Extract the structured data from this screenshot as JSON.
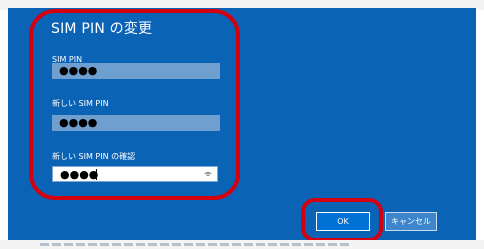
{
  "dialog": {
    "title": "SIM PIN の変更",
    "fields": [
      {
        "label": "SIM PIN",
        "value": "●●●●"
      },
      {
        "label": "新しい SIM PIN",
        "value": "●●●●"
      },
      {
        "label": "新しい SIM PIN の確認",
        "value": "●●●●"
      }
    ],
    "reveal_icon": "eye-icon",
    "buttons": {
      "ok": "OK",
      "cancel": "キャンセル"
    }
  },
  "colors": {
    "dialog_background": "#0b63b6",
    "inactive_field": "#6f9fcf",
    "highlight": "#d4000f"
  }
}
